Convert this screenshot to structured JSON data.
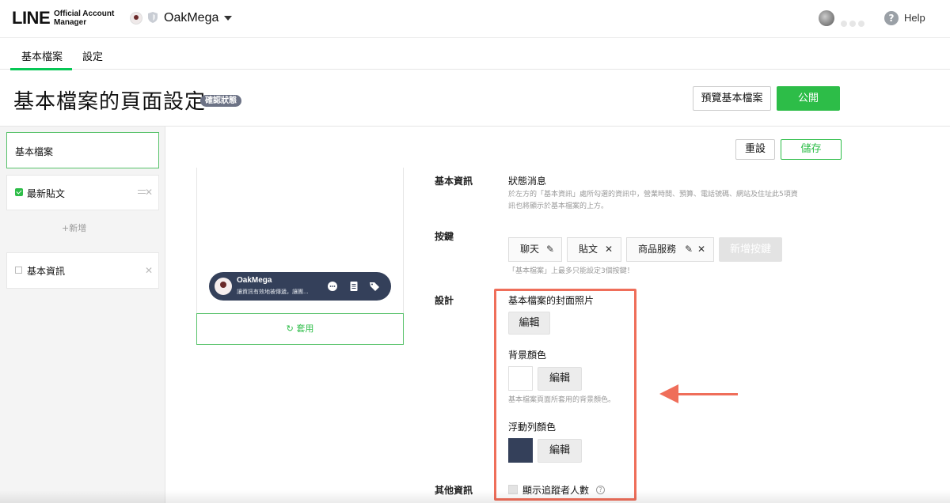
{
  "app": {
    "logo_main": "LINE",
    "logo_sub_1": "Official Account",
    "logo_sub_2": "Manager",
    "account_name": "OakMega",
    "help_label": "Help"
  },
  "tabs": [
    {
      "label": "基本檔案",
      "active": true
    },
    {
      "label": "設定",
      "active": false
    }
  ],
  "header": {
    "page_title": "基本檔案的頁面設定",
    "status_badge": "確認狀態",
    "preview_button": "預覽基本檔案",
    "publish_button": "公開"
  },
  "toolbar": {
    "reset_button": "重設",
    "save_button": "儲存"
  },
  "sidebar": {
    "items": [
      {
        "label": "基本檔案",
        "active": true
      },
      {
        "label": "最新貼文",
        "checked": true
      },
      {
        "label": "基本資訊",
        "checked": false
      }
    ],
    "add_label": "+新增"
  },
  "preview": {
    "float_bar_name": "OakMega",
    "float_bar_text": "讓資訊有效地被傳遞，讓團...",
    "apply_button": "套用"
  },
  "settings": {
    "basic_info": {
      "section_label": "基本資訊",
      "title": "狀態消息",
      "desc_line1": "於左方的「基本資訊」處所勾選的資訊中，營業時間、預算、電話號碼、網站及住址此5項資",
      "desc_line2": "訊也將顯示於基本檔案的上方。"
    },
    "buttons": {
      "section_label": "按鍵",
      "items": [
        {
          "label": "聊天",
          "icon": "pencil-icon"
        },
        {
          "label": "貼文",
          "icon": "close-icon"
        },
        {
          "label": "商品服務",
          "icon": "pencil-icon"
        }
      ],
      "add_button": "新增按鍵",
      "hint": "「基本檔案」上最多只能設定3個按鍵！"
    },
    "design": {
      "section_label": "設計",
      "cover_title": "基本檔案的封面照片",
      "cover_edit": "編輯",
      "bg_title": "背景顏色",
      "bg_edit": "編輯",
      "bg_color": "#ffffff",
      "bg_hint": "基本檔案頁面所套用的背景顏色。",
      "float_title": "浮動列顏色",
      "float_edit": "編輯",
      "float_color": "#34405a"
    },
    "other_info": {
      "section_label": "其他資訊",
      "follower_label": "顯示追蹤者人數"
    }
  },
  "colors": {
    "accent_green": "#2dbd48",
    "highlight_red": "#ef6e5a",
    "badge_gray": "#6c7285"
  }
}
